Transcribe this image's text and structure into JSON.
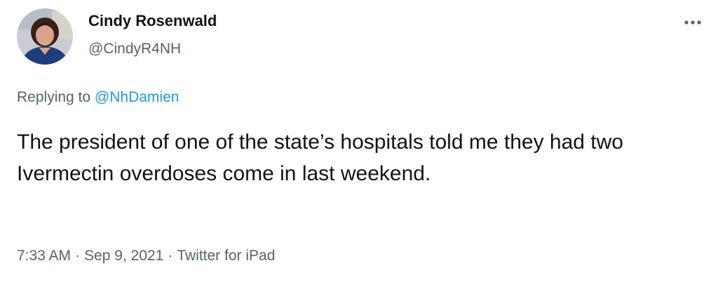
{
  "author": {
    "display_name": "Cindy Rosenwald",
    "handle": "@CindyR4NH"
  },
  "more_icon": "more-horizontal-icon",
  "reply": {
    "prefix": "Replying to",
    "mention": "@NhDamien"
  },
  "tweet": {
    "text": "The president of one of the state’s hospitals told me they had two Ivermectin overdoses come in last weekend."
  },
  "meta": {
    "time": "7:33 AM",
    "date": "Sep 9, 2021",
    "separator": "·",
    "source": "Twitter for iPad"
  },
  "colors": {
    "text_primary": "#0f1419",
    "text_secondary": "#536471",
    "link": "#1d9bf0",
    "background": "#ffffff"
  }
}
